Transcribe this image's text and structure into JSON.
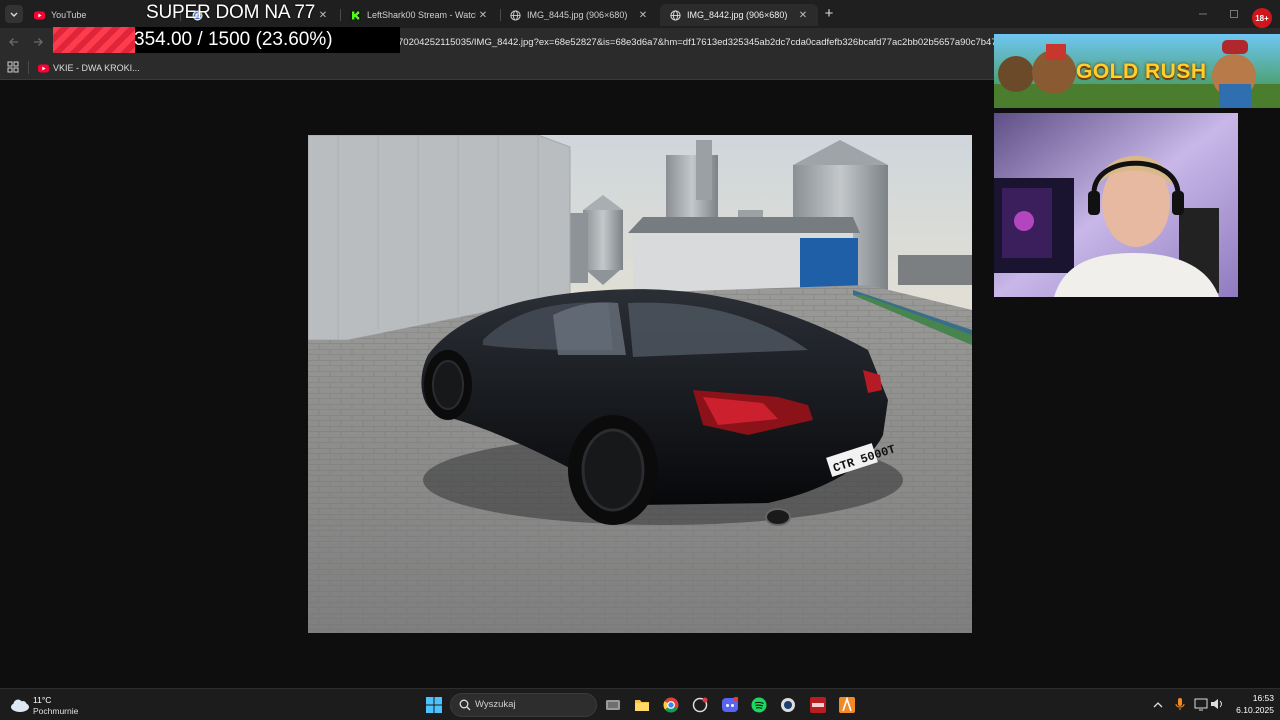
{
  "overlay": {
    "title": "SUPER DOM NA 77",
    "progress_text": "354.00 / 1500 (23.60%)",
    "progress_fraction": 0.236
  },
  "tabs": [
    {
      "label": "YouTube",
      "icon": "youtube-icon"
    },
    {
      "label": "",
      "icon": "google-icon"
    },
    {
      "label": "LeftShark00 Stream - Watch Li",
      "icon": "kick-icon"
    },
    {
      "label": "IMG_8445.jpg (906×680)",
      "icon": "globe-icon"
    },
    {
      "label": "IMG_8442.jpg (906×680)",
      "icon": "globe-icon"
    }
  ],
  "address_bar": {
    "url_visible": "70204252115035/IMG_8442.jpg?ex=68e52827&is=68e3d6a7&hm=df17613ed325345ab2dc7cda0cadfefb326bcafd77ac2bb02b5657a90c7b47e4&"
  },
  "bookmarks": [
    {
      "label": "VKIE - DWA KROKI...",
      "icon": "youtube-icon"
    }
  ],
  "banner": {
    "text": "GOLD RUSH"
  },
  "badge": {
    "text": "18+"
  },
  "photo": {
    "plate": "CTR 5000T"
  },
  "taskbar": {
    "weather_temp": "11°C",
    "weather_desc": "Pochmurnie",
    "search_placeholder": "Wyszukaj",
    "time": "16:53",
    "date": "6.10.2025"
  },
  "colors": {
    "tab_strip": "#1f1f1f",
    "toolbar": "#2b2b2b",
    "progress_fill": "#ff3b4e",
    "taskbar": "#1c1c1c"
  }
}
